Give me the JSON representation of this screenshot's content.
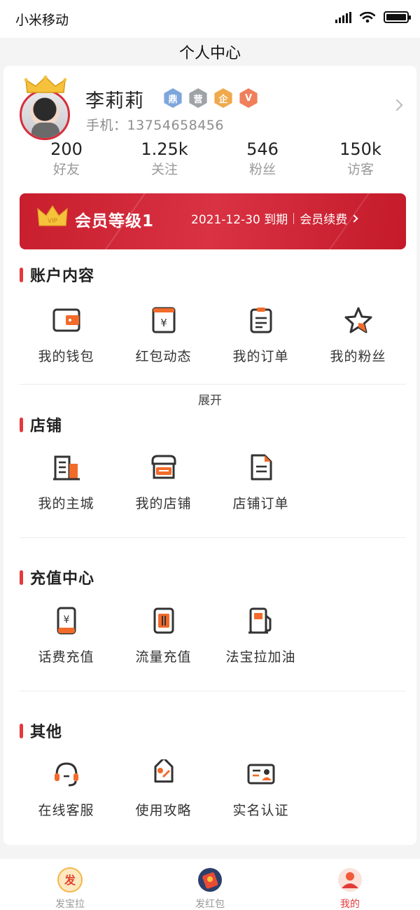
{
  "status_bar": {
    "carrier": "小米移动"
  },
  "nav": {
    "title": "个人中心"
  },
  "profile": {
    "name": "李莉莉",
    "phone_label": "手机：",
    "phone": "13754658456",
    "badges": [
      {
        "text": "鼎",
        "color": "#7da6dc"
      },
      {
        "text": "营",
        "color": "#9ea3a8"
      },
      {
        "text": "企",
        "color": "#f0a94c"
      },
      {
        "text": "V",
        "color": "#f07f5c"
      }
    ]
  },
  "stats": [
    {
      "value": "200",
      "label": "好友"
    },
    {
      "value": "1.25k",
      "label": "关注"
    },
    {
      "value": "546",
      "label": "粉丝"
    },
    {
      "value": "150k",
      "label": "访客"
    }
  ],
  "vip": {
    "level": "会员等级1",
    "expiry": "2021-12-30 到期",
    "renew": "会员续费",
    "crown_text": "VIP"
  },
  "sections": {
    "account": {
      "title": "账户内容",
      "items": [
        {
          "label": "我的钱包",
          "icon": "wallet-icon"
        },
        {
          "label": "红包动态",
          "icon": "red-packet-icon"
        },
        {
          "label": "我的订单",
          "icon": "order-clipboard-icon"
        },
        {
          "label": "我的粉丝",
          "icon": "star-icon"
        }
      ],
      "expand": "展开"
    },
    "store": {
      "title": "店铺",
      "items": [
        {
          "label": "我的主城",
          "icon": "city-building-icon"
        },
        {
          "label": "我的店铺",
          "icon": "shop-icon"
        },
        {
          "label": "店铺订单",
          "icon": "document-icon"
        }
      ]
    },
    "recharge": {
      "title": "充值中心",
      "items": [
        {
          "label": "话费充值",
          "icon": "phone-bill-icon"
        },
        {
          "label": "流量充值",
          "icon": "data-sim-icon"
        },
        {
          "label": "法宝拉加油",
          "icon": "fuel-pump-icon"
        }
      ]
    },
    "other": {
      "title": "其他",
      "items": [
        {
          "label": "在线客服",
          "icon": "headset-icon"
        },
        {
          "label": "使用攻略",
          "icon": "tag-guide-icon"
        },
        {
          "label": "实名认证",
          "icon": "id-card-icon"
        }
      ]
    }
  },
  "tabbar": [
    {
      "label": "发宝拉",
      "icon": "fabaola-icon",
      "active": false,
      "icon_text": "发"
    },
    {
      "label": "发红包",
      "icon": "red-envelope-icon",
      "active": false
    },
    {
      "label": "我的",
      "icon": "profile-avatar-icon",
      "active": true
    }
  ],
  "colors": {
    "accent": "#e4393c",
    "orange": "#f26b2a",
    "icon_dark": "#333333"
  }
}
